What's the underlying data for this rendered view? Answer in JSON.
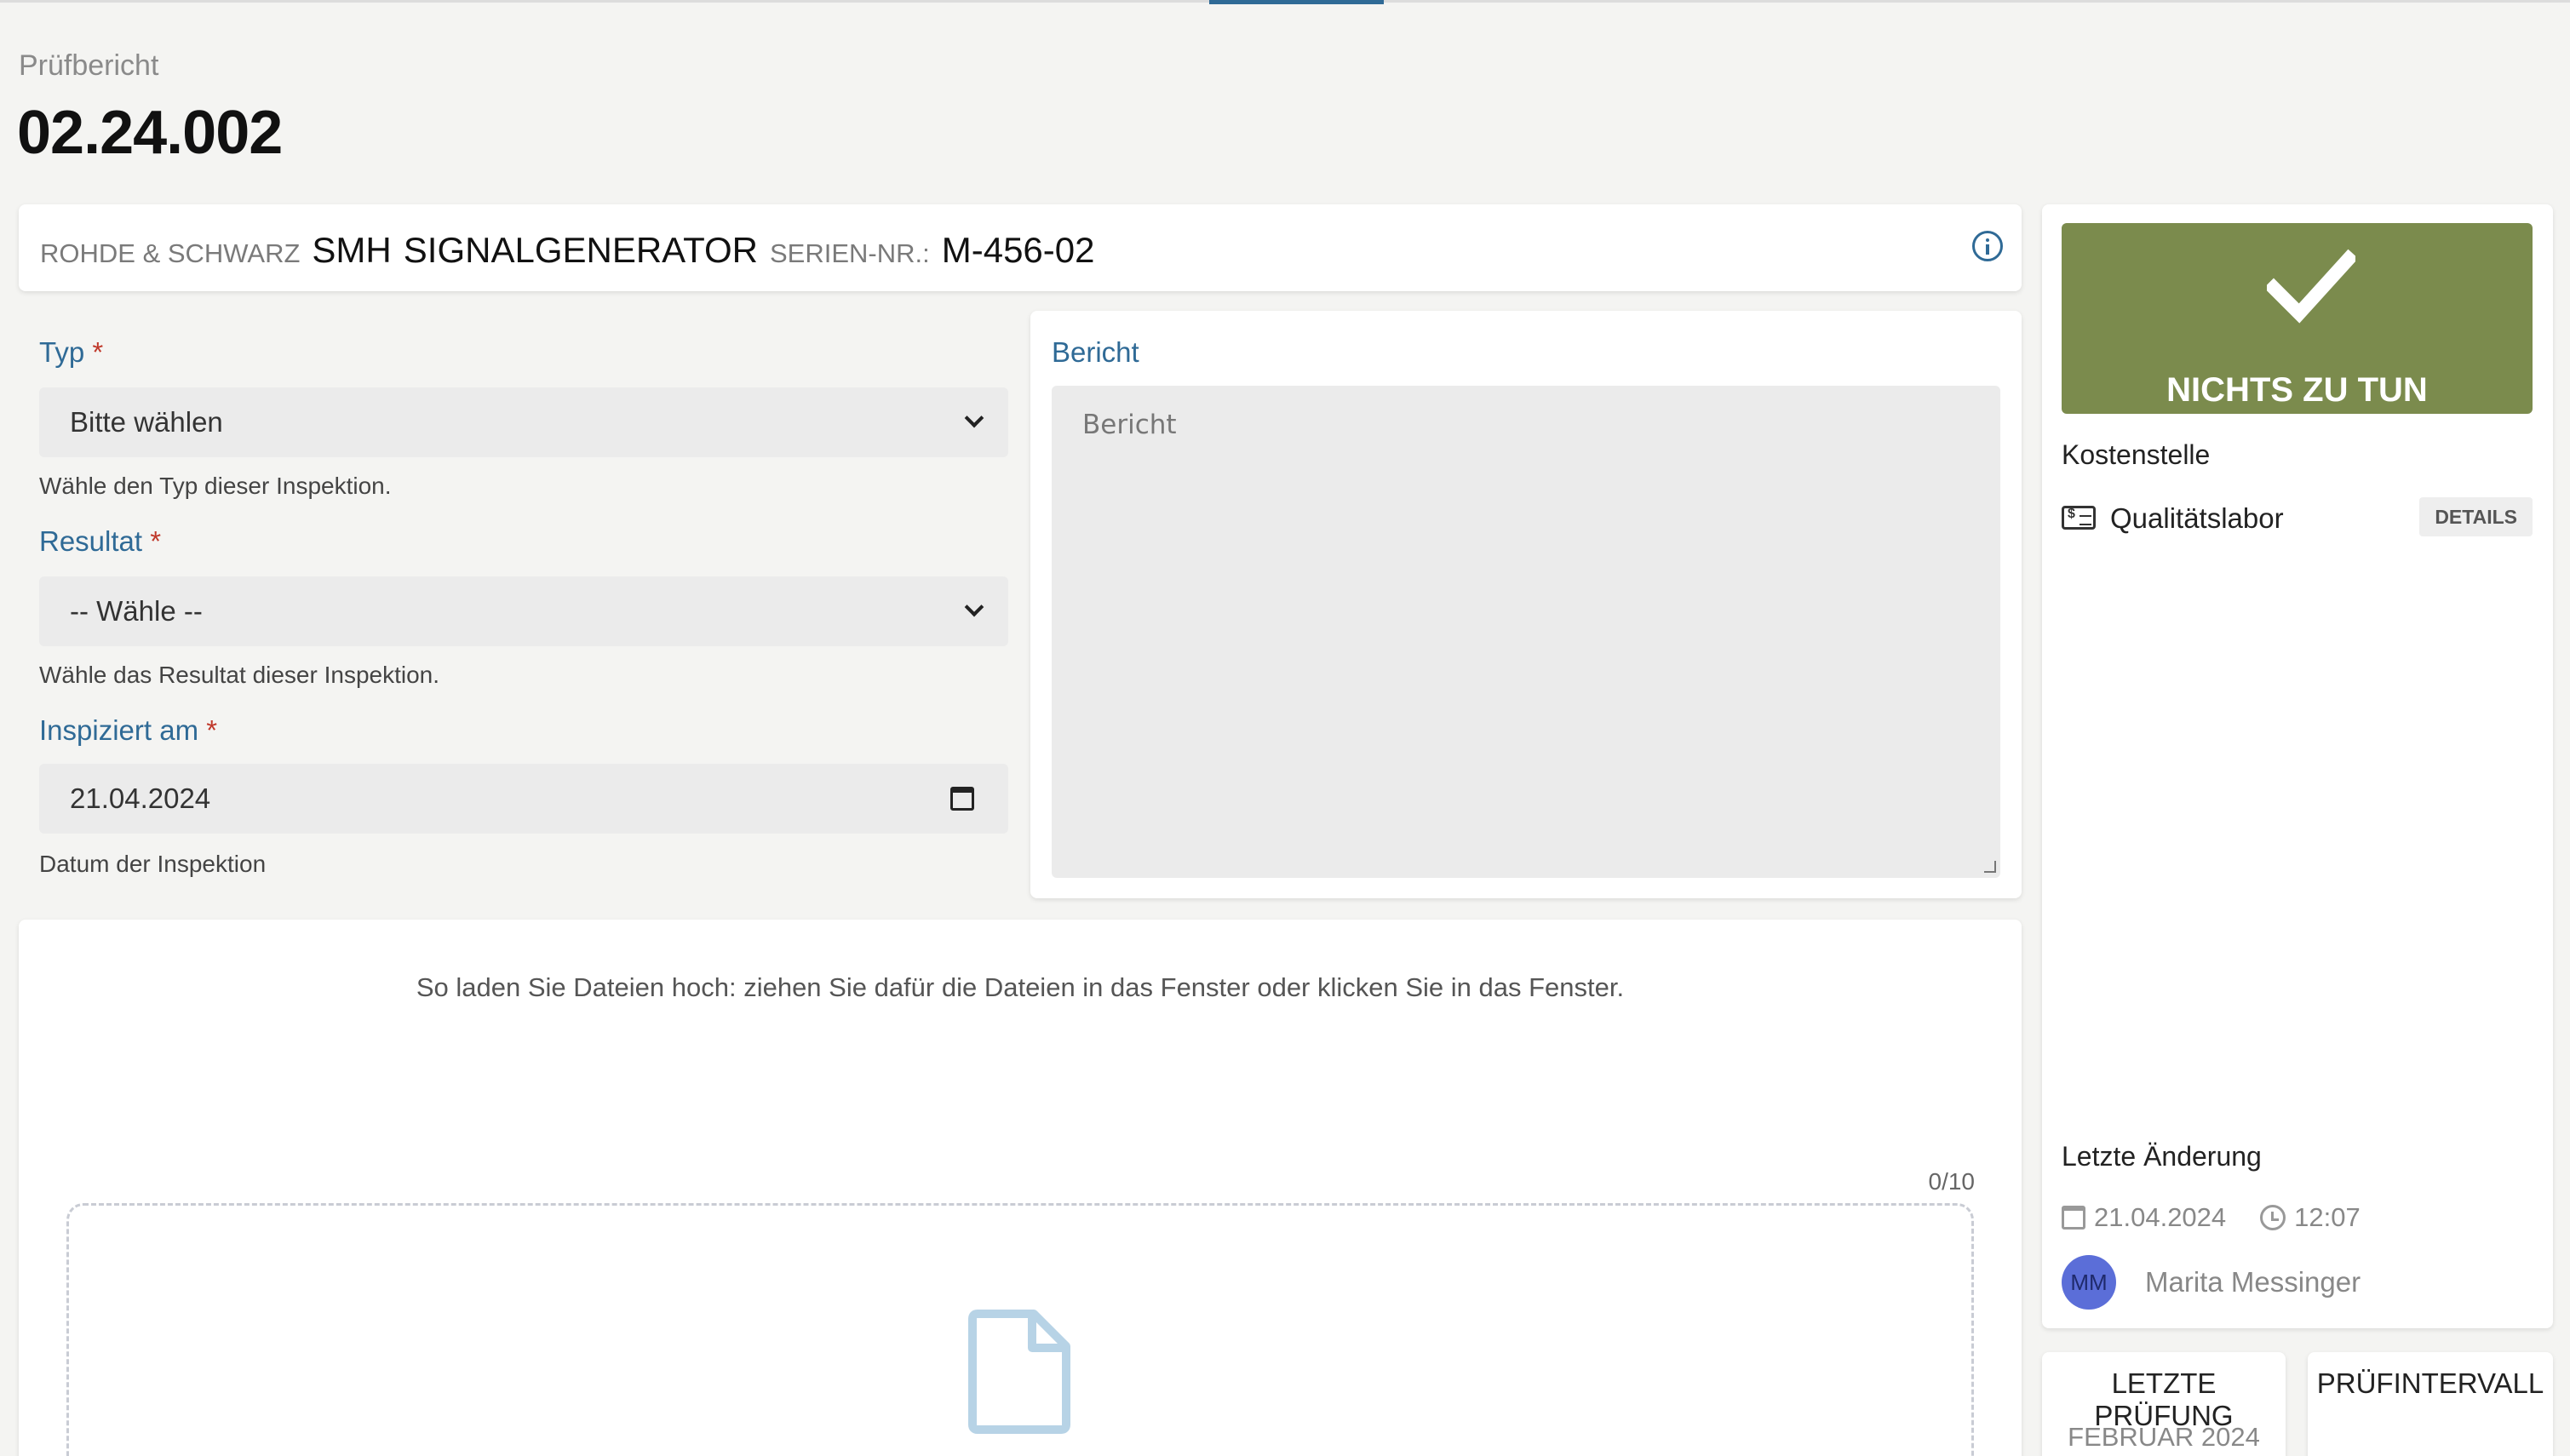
{
  "page": {
    "subtitle": "Prüfbericht",
    "title": "02.24.002"
  },
  "device": {
    "manufacturer": "ROHDE & SCHWARZ",
    "model": "SMH",
    "name": "SIGNALGENERATOR",
    "serial_label": "SERIEN-NR.:",
    "serial": "M-456-02",
    "info_icon": "info-icon"
  },
  "form": {
    "typ": {
      "label": "Typ",
      "required": "*",
      "value": "Bitte wählen",
      "help": "Wähle den Typ dieser Inspektion."
    },
    "resultat": {
      "label": "Resultat",
      "required": "*",
      "value": "-- Wähle --",
      "help": "Wähle das Resultat dieser Inspektion."
    },
    "inspiziert": {
      "label": "Inspiziert am",
      "required": "*",
      "value": "21.04.2024",
      "help": "Datum der Inspektion"
    }
  },
  "report": {
    "label": "Bericht",
    "placeholder": "Bericht"
  },
  "upload": {
    "instructions": "So laden Sie Dateien hoch: ziehen Sie dafür die Dateien in das Fenster oder klicken Sie in das Fenster.",
    "count": "0/10",
    "icon": "file-icon"
  },
  "sidebar": {
    "status": {
      "text": "NICHTS ZU TUN",
      "color": "#7b8b4d",
      "icon": "check-icon"
    },
    "cost_center": {
      "label": "Kostenstelle",
      "name": "Qualitätslabor",
      "details_label": "DETAILS"
    },
    "last_change": {
      "label": "Letzte Änderung",
      "date": "21.04.2024",
      "time": "12:07",
      "user_initials": "MM",
      "user_name": "Marita Messinger"
    },
    "last_inspection": {
      "label": "LETZTE PRÜFUNG",
      "value": "FEBRUAR 2024"
    },
    "interval": {
      "label": "PRÜFINTERVALL"
    }
  },
  "colors": {
    "accent": "#2f6a96",
    "required": "#c0392b",
    "avatar": "#5b6ed8"
  }
}
